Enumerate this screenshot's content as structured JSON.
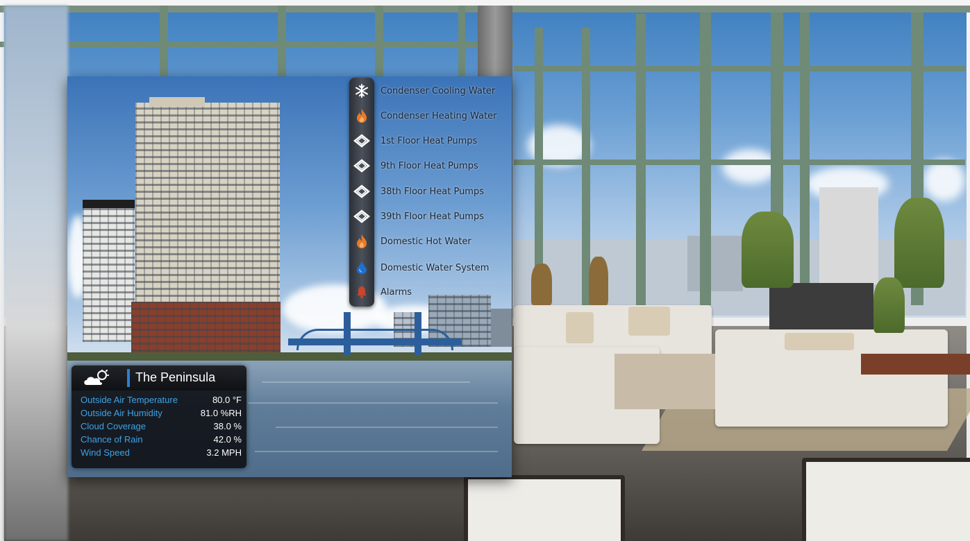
{
  "building": {
    "name": "The Peninsula"
  },
  "menu": {
    "items": [
      {
        "label": "Condenser Cooling Water",
        "icon": "snowflake-icon"
      },
      {
        "label": "Condenser Heating Water",
        "icon": "flame-icon"
      },
      {
        "label": "1st Floor Heat Pumps",
        "icon": "heat-pump-icon"
      },
      {
        "label": "9th Floor Heat Pumps",
        "icon": "heat-pump-icon"
      },
      {
        "label": "38th Floor Heat Pumps",
        "icon": "heat-pump-icon"
      },
      {
        "label": "39th Floor Heat Pumps",
        "icon": "heat-pump-icon"
      },
      {
        "label": "Domestic Hot Water",
        "icon": "flame-icon"
      },
      {
        "label": "Domestic Water System",
        "icon": "water-drop-icon"
      },
      {
        "label": "Alarms",
        "icon": "bell-icon"
      }
    ]
  },
  "weather": {
    "icon": "cloud-sun-icon",
    "rows": [
      {
        "label": "Outside Air Temperature",
        "value": "80.0 °F"
      },
      {
        "label": "Outside Air Humidity",
        "value": "81.0 %RH"
      },
      {
        "label": "Cloud Coverage",
        "value": "38.0 %"
      },
      {
        "label": "Chance of Rain",
        "value": "42.0 %"
      },
      {
        "label": "Wind Speed",
        "value": "3.2 MPH"
      }
    ]
  },
  "colors": {
    "label_blue": "#3fa3e6",
    "flame_orange": "#e8792a",
    "accent_blue": "#2a7fd4"
  }
}
